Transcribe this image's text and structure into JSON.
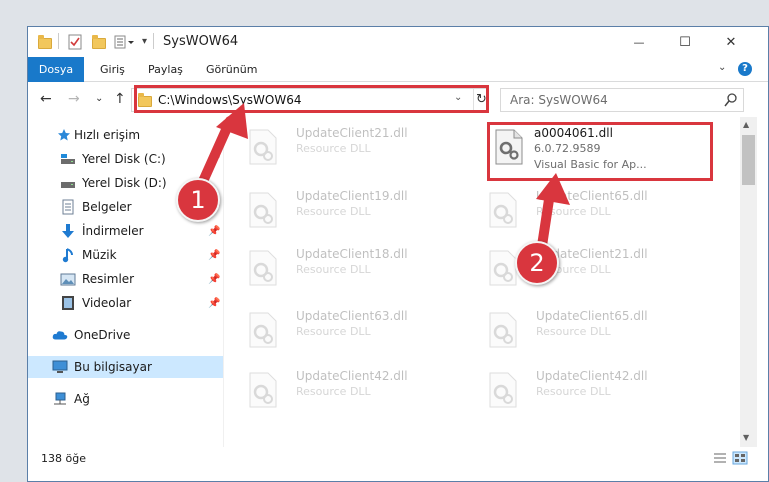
{
  "window": {
    "title": "SysWOW64",
    "minimize_glyph": "—",
    "maximize_glyph": "☐",
    "close_glyph": "✕"
  },
  "ribbon": {
    "file_tab": "Dosya",
    "tabs": [
      "Giriş",
      "Paylaş",
      "Görünüm"
    ],
    "help": "?"
  },
  "nav": {
    "address": "C:\\Windows\\SysWOW64",
    "search_placeholder": "Ara: SysWOW64"
  },
  "sidebar": {
    "items": [
      {
        "label": "Hızlı erişim",
        "icon": "star-icon"
      },
      {
        "label": "Yerel Disk (C:)",
        "icon": "drive-icon"
      },
      {
        "label": "Yerel Disk (D:)",
        "icon": "drive-icon"
      },
      {
        "label": "Belgeler",
        "icon": "documents-icon"
      },
      {
        "label": "İndirmeler",
        "icon": "downloads-icon"
      },
      {
        "label": "Müzik",
        "icon": "music-icon"
      },
      {
        "label": "Resimler",
        "icon": "pictures-icon"
      },
      {
        "label": "Videolar",
        "icon": "videos-icon"
      },
      {
        "label": "OneDrive",
        "icon": "cloud-icon"
      },
      {
        "label": "Bu bilgisayar",
        "icon": "computer-icon"
      },
      {
        "label": "Ağ",
        "icon": "network-icon"
      }
    ]
  },
  "files": {
    "highlighted": {
      "name": "a0004061.dll",
      "version": "6.0.72.9589",
      "description": "Visual Basic for Ap..."
    },
    "left_column": [
      {
        "name": "UpdateClient21.dll",
        "type": "Resource DLL"
      },
      {
        "name": "UpdateClient19.dll",
        "type": "Resource DLL"
      },
      {
        "name": "UpdateClient18.dll",
        "type": "Resource DLL"
      },
      {
        "name": "UpdateClient63.dll",
        "type": "Resource DLL"
      },
      {
        "name": "UpdateClient42.dll",
        "type": "Resource DLL"
      }
    ],
    "right_column": [
      {
        "name": "UpdateClient65.dll",
        "type": "Resource DLL"
      },
      {
        "name": "UpdateClient21.dll",
        "type": "Resource DLL"
      },
      {
        "name": "UpdateClient65.dll",
        "type": "Resource DLL"
      },
      {
        "name": "UpdateClient42.dll",
        "type": "Resource DLL"
      }
    ]
  },
  "status": {
    "item_count": "138 öğe"
  },
  "annotations": {
    "badge_1": "1",
    "badge_2": "2",
    "color": "#d9363e"
  }
}
